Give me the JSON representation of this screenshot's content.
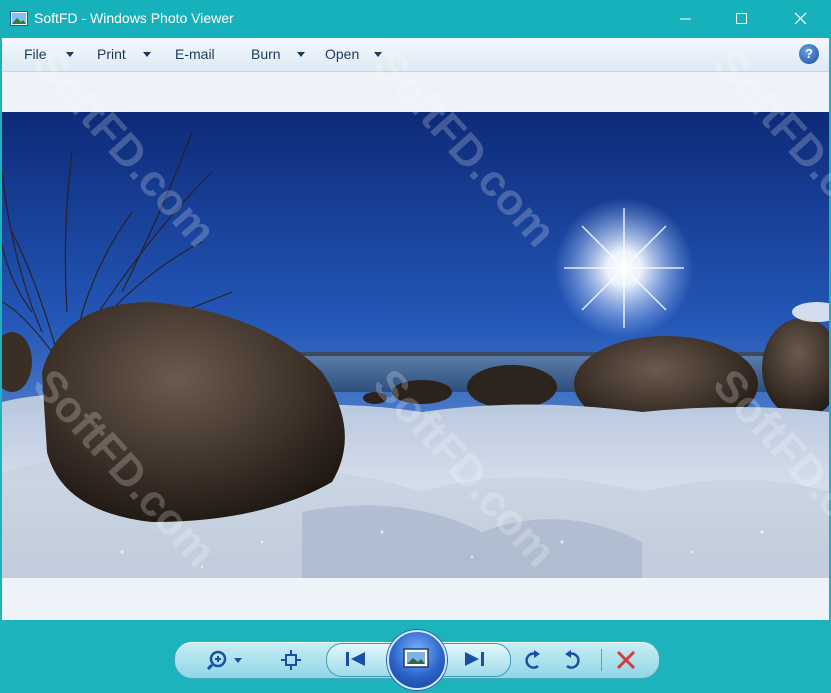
{
  "window": {
    "title": "SoftFD - Windows Photo Viewer",
    "title_bar_color": "#17b1bb"
  },
  "titlebar_buttons": {
    "minimize_icon": "minimize-icon",
    "maximize_icon": "maximize-icon",
    "close_icon": "close-icon"
  },
  "menu": {
    "items": [
      {
        "label": "File",
        "has_dropdown": true
      },
      {
        "label": "Print",
        "has_dropdown": true
      },
      {
        "label": "E-mail",
        "has_dropdown": false
      },
      {
        "label": "Burn",
        "has_dropdown": true
      },
      {
        "label": "Open",
        "has_dropdown": true
      }
    ],
    "help_label": "?"
  },
  "viewer": {
    "background": "#eef3fa",
    "photo_subject": "snowy-shore-rocks-sun-photo"
  },
  "controls": {
    "zoom_icon": "zoom-icon",
    "actual_size_icon": "actual-size-icon",
    "previous_icon": "previous-icon",
    "slideshow_icon": "slideshow-icon",
    "next_icon": "next-icon",
    "rotate_ccw_icon": "rotate-counterclockwise-icon",
    "rotate_cw_icon": "rotate-clockwise-icon",
    "delete_icon": "delete-icon"
  },
  "watermark": {
    "text": "SoftFD.com"
  }
}
